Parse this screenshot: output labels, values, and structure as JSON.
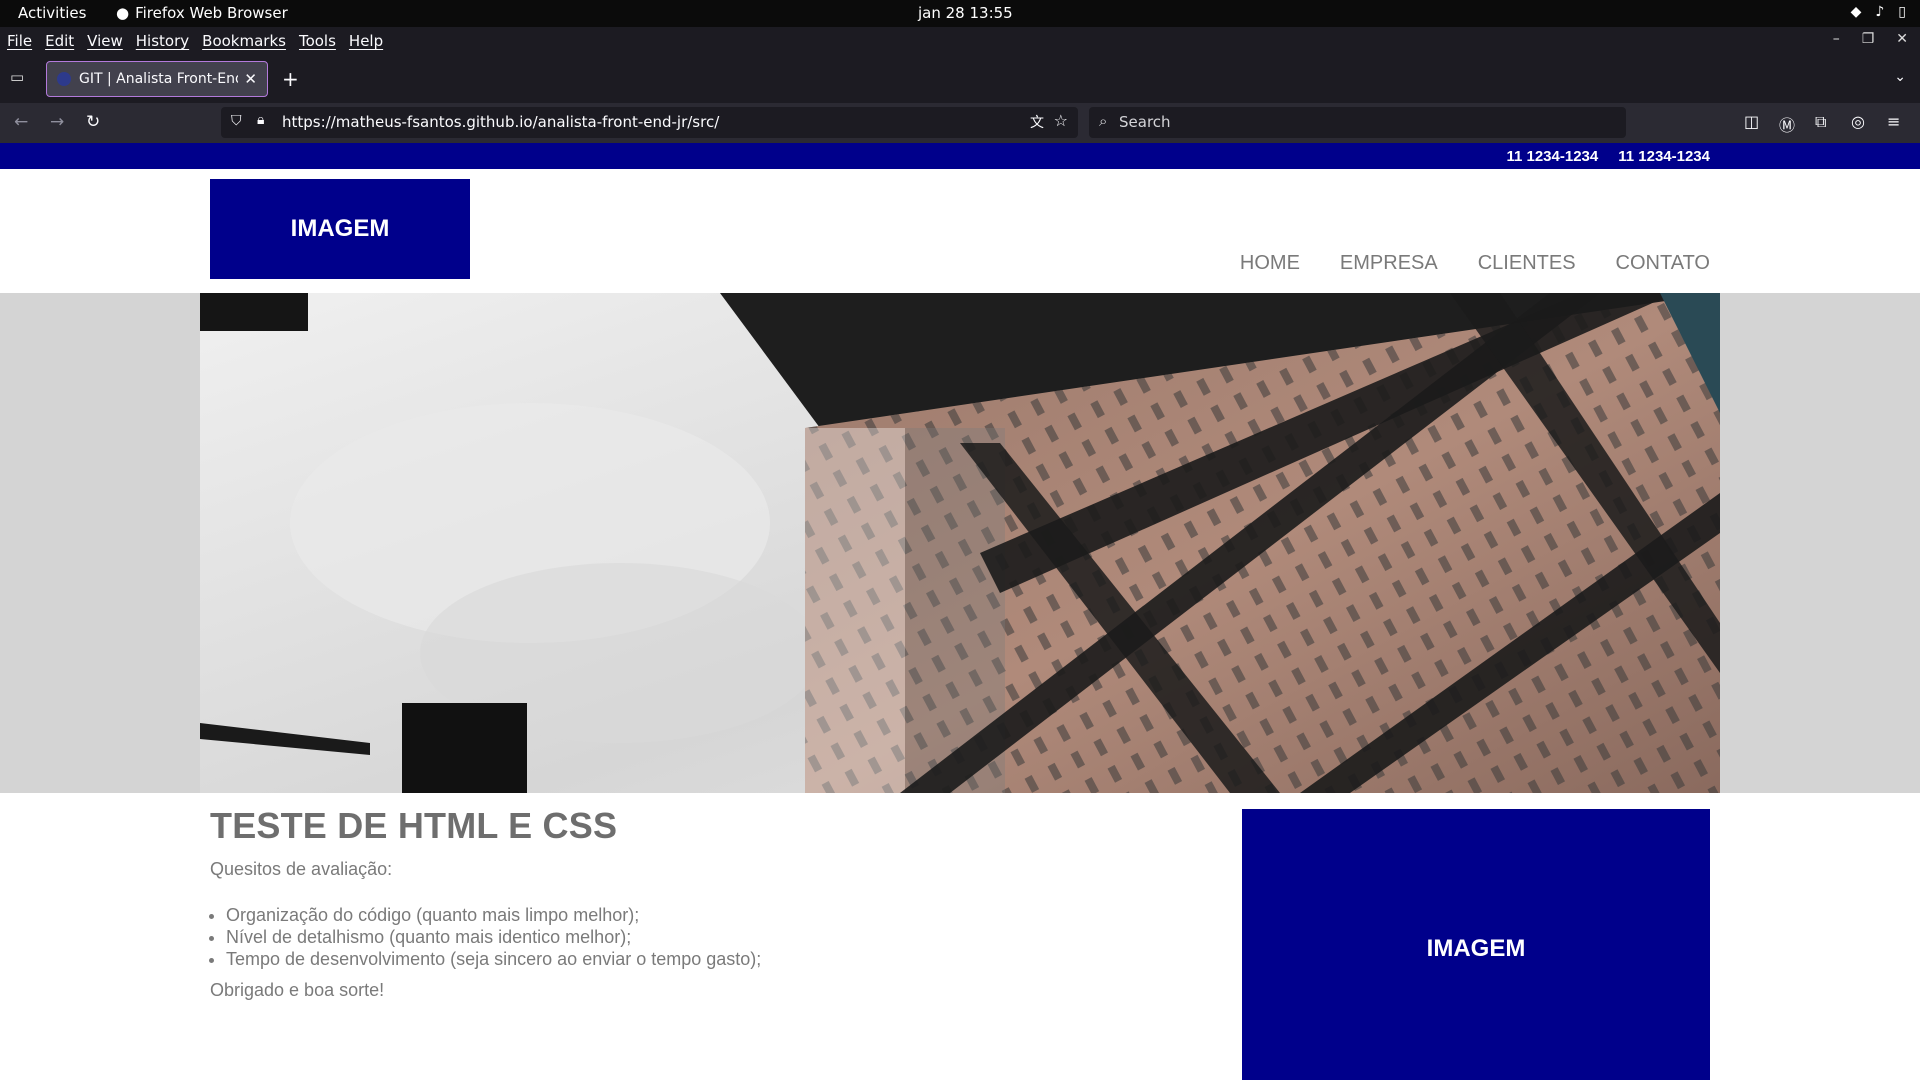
{
  "gnome": {
    "activities": "Activities",
    "app_name": "Firefox Web Browser",
    "clock": "jan 28  13:55"
  },
  "menubar": {
    "items": [
      "File",
      "Edit",
      "View",
      "History",
      "Bookmarks",
      "Tools",
      "Help"
    ]
  },
  "tab": {
    "title": "GIT | Analista Front-End Jr"
  },
  "urlbar": {
    "url": "https://matheus-fsantos.github.io/analista-front-end-jr/src/"
  },
  "searchbar": {
    "placeholder": "Search"
  },
  "site": {
    "phones": [
      "11 1234-1234",
      "11 1234-1234"
    ],
    "logo_text": "IMAGEM",
    "nav": [
      "HOME",
      "EMPRESA",
      "CLIENTES",
      "CONTATO"
    ],
    "heading": "TESTE DE HTML E CSS",
    "subheading": "Quesitos de avaliação:",
    "criteria": [
      "Organização do código (quanto mais limpo melhor);",
      "Nível de detalhismo (quanto mais identico melhor);",
      "Tempo de desenvolvimento (seja sincero ao enviar o tempo gasto);"
    ],
    "thanks": "Obrigado e boa sorte!",
    "side_image_text": "IMAGEM"
  },
  "colors": {
    "brand_blue": "#00008b",
    "text_gray": "#7a7a7a",
    "hero_side_gray": "#d4d4d4"
  },
  "icons": [
    "firefox-icon",
    "wifi-icon",
    "volume-icon",
    "battery-icon",
    "back-icon",
    "forward-icon",
    "reload-icon",
    "shield-icon",
    "lock-icon",
    "translate-icon",
    "bookmark-star-icon",
    "search-icon",
    "pocket-icon",
    "account-icon",
    "extensions-icon",
    "vpn-icon",
    "menu-icon"
  ]
}
